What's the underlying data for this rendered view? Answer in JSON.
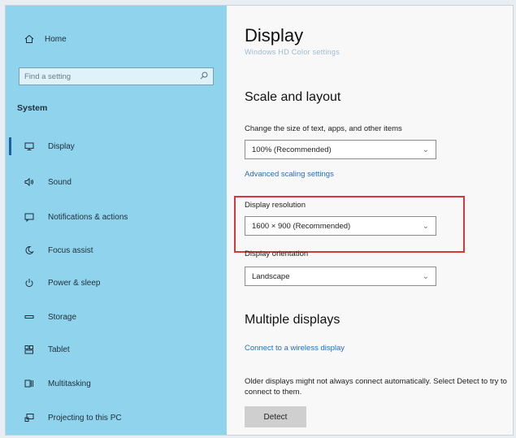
{
  "sidebar": {
    "home_label": "Home",
    "search_placeholder": "Find a setting",
    "section_label": "System",
    "items": [
      {
        "label": "Display",
        "icon": "monitor-icon"
      },
      {
        "label": "Sound",
        "icon": "speaker-icon"
      },
      {
        "label": "Notifications & actions",
        "icon": "notification-icon"
      },
      {
        "label": "Focus assist",
        "icon": "moon-icon"
      },
      {
        "label": "Power & sleep",
        "icon": "power-icon"
      },
      {
        "label": "Storage",
        "icon": "storage-icon"
      },
      {
        "label": "Tablet",
        "icon": "tablet-icon"
      },
      {
        "label": "Multitasking",
        "icon": "multitasking-icon"
      },
      {
        "label": "Projecting to this PC",
        "icon": "projector-icon"
      }
    ],
    "active_item": "Display"
  },
  "main": {
    "title": "Display",
    "scrolled_link": "Windows HD Color settings",
    "scale_heading": "Scale and layout",
    "scale_label": "Change the size of text, apps, and other items",
    "scale_value": "100% (Recommended)",
    "advanced_link": "Advanced scaling settings",
    "resolution_label": "Display resolution",
    "resolution_value": "1600 × 900 (Recommended)",
    "orientation_label": "Display orientation",
    "orientation_value": "Landscape",
    "multi_heading": "Multiple displays",
    "wireless_link": "Connect to a wireless display",
    "multi_description": "Older displays might not always connect automatically. Select Detect to try to connect to them.",
    "detect_button": "Detect"
  },
  "colors": {
    "sidebar_bg": "#8fd3ec",
    "accent": "#1e5ea8",
    "highlight_border": "#d9383a",
    "link": "#2a6db0"
  }
}
